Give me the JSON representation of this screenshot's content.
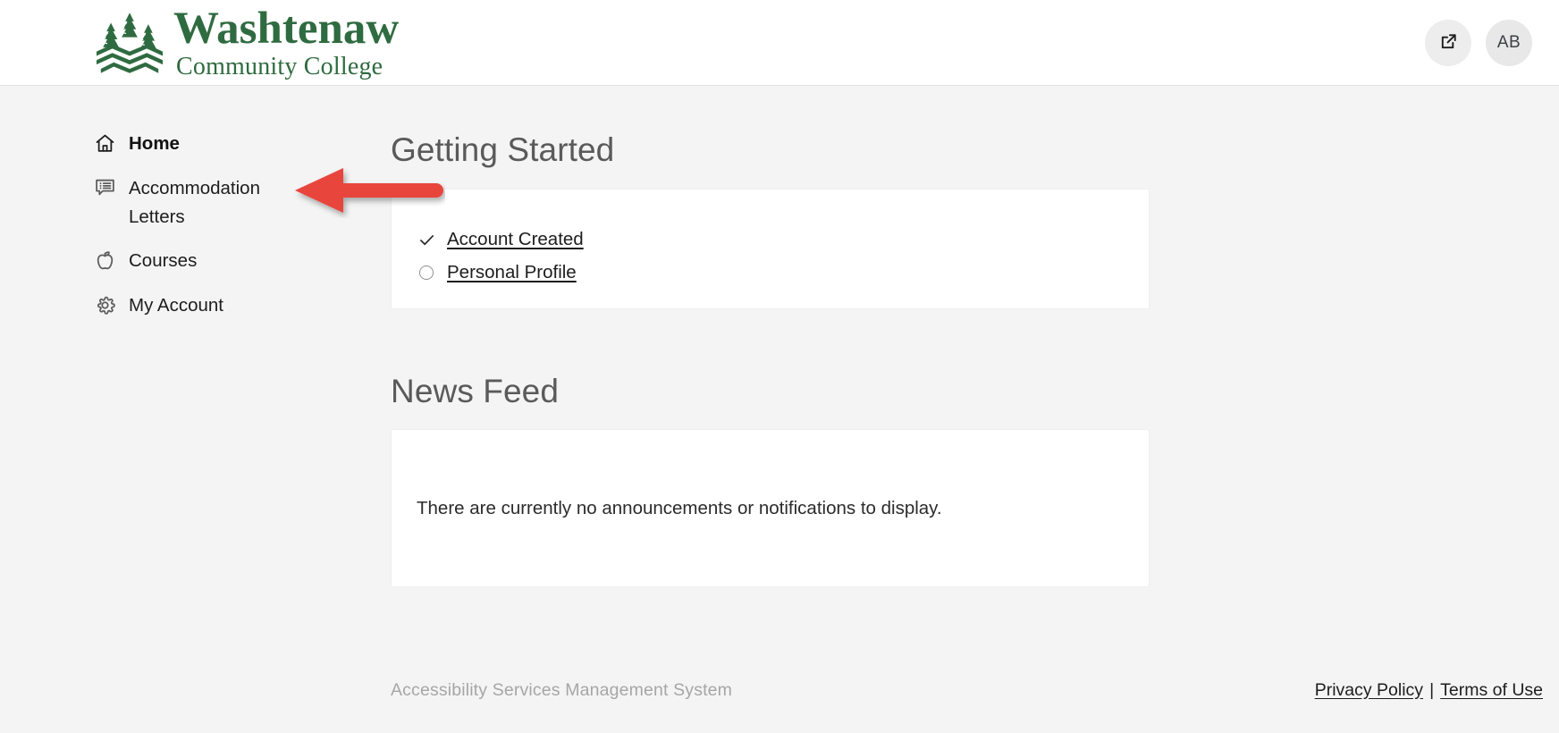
{
  "header": {
    "logo": {
      "icon": "washtenaw-tree-logo",
      "line1": "Washtenaw",
      "line2": "Community College",
      "color": "#2f6b40"
    },
    "actions": {
      "external_link_icon": "external-link-icon",
      "external_link_label": "Open in new window",
      "avatar_initials": "AB"
    }
  },
  "sidebar": {
    "items": [
      {
        "label": "Home",
        "icon": "home-icon",
        "active": true
      },
      {
        "label": "Accommodation Letters",
        "icon": "message-list-icon",
        "active": false
      },
      {
        "label": "Courses",
        "icon": "apple-icon",
        "active": false
      },
      {
        "label": "My Account",
        "icon": "gear-icon",
        "active": false
      }
    ]
  },
  "main": {
    "getting_started": {
      "title": "Getting Started",
      "steps": [
        {
          "label": "Account Created",
          "status_icon": "check-icon",
          "complete": true
        },
        {
          "label": "Personal Profile",
          "status_icon": "empty-circle-icon",
          "complete": false
        }
      ]
    },
    "news_feed": {
      "title": "News Feed",
      "empty_message": "There are currently no announcements or notifications to display."
    }
  },
  "footer": {
    "system_name": "Accessibility Services Management System",
    "separator": "|",
    "links": [
      {
        "label": "Privacy Policy"
      },
      {
        "label": "Terms of Use"
      }
    ]
  },
  "annotation": {
    "type": "arrow",
    "direction": "left",
    "color": "#e8453c",
    "points_at": "Accommodation Letters"
  },
  "theme": {
    "page_background": "#f4f4f4",
    "header_background": "#ffffff",
    "card_background": "#ffffff",
    "brand_green": "#2f6b40",
    "annotation_red": "#e8453c",
    "muted_text": "#a6a6a6"
  }
}
